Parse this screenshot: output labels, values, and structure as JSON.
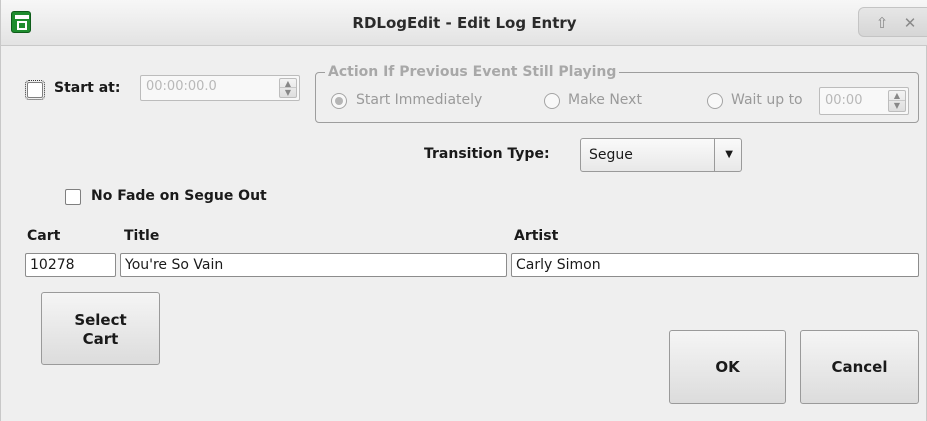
{
  "window": {
    "title": "RDLogEdit - Edit Log Entry"
  },
  "start_at": {
    "label": "Start at:",
    "value": "00:00:00.0"
  },
  "action_group": {
    "title": "Action If Previous Event Still Playing",
    "options": [
      {
        "label": "Start Immediately",
        "selected": true
      },
      {
        "label": "Make Next",
        "selected": false
      },
      {
        "label": "Wait up to",
        "selected": false
      }
    ],
    "wait_value": "00:00"
  },
  "transition": {
    "label": "Transition Type:",
    "value": "Segue"
  },
  "no_fade": {
    "label": "No Fade on Segue Out"
  },
  "fields": {
    "cart_label": "Cart",
    "title_label": "Title",
    "artist_label": "Artist",
    "cart_value": "10278",
    "title_value": "You're So Vain",
    "artist_value": "Carly Simon"
  },
  "buttons": {
    "select_cart_line1": "Select",
    "select_cart_line2": "Cart",
    "ok": "OK",
    "cancel": "Cancel"
  },
  "colors": {
    "accent_icon": "#1e8c2e",
    "disabled_text": "#9a9a9a"
  }
}
